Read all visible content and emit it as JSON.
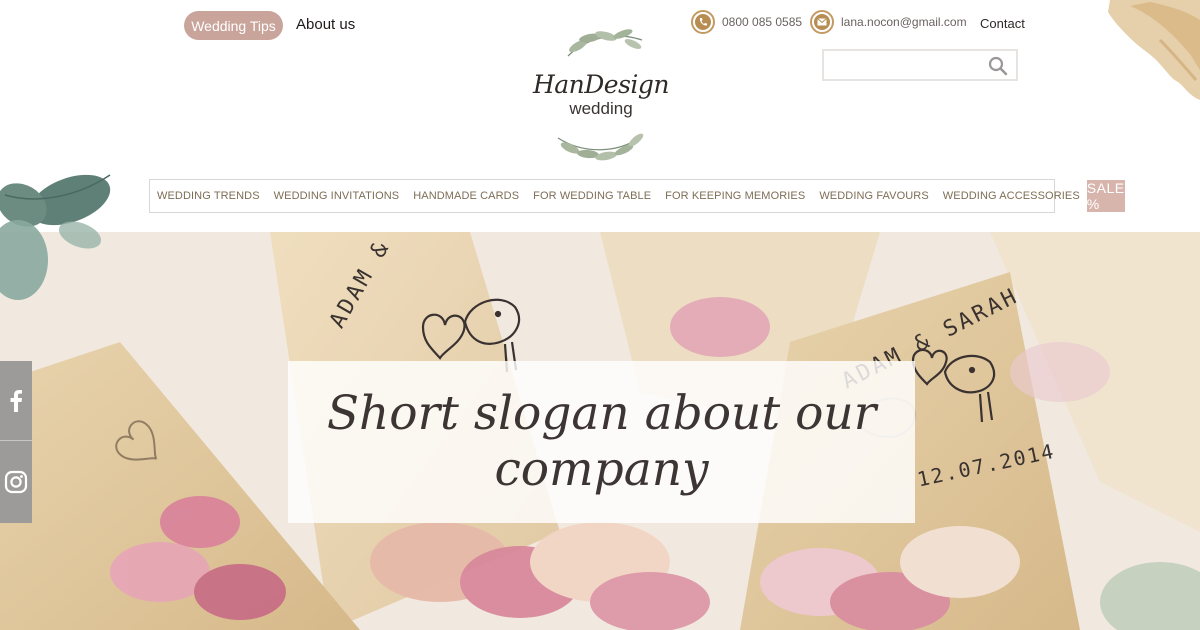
{
  "header": {
    "tips_button": "Wedding Tips",
    "about_link": "About us",
    "phone": "0800 085 0585",
    "email": "lana.nocon@gmail.com",
    "contact_link": "Contact",
    "search_placeholder": ""
  },
  "logo": {
    "name": "HanDesign",
    "subtitle": "wedding"
  },
  "nav": {
    "items": [
      "WEDDING TRENDS",
      "WEDDING INVITATIONS",
      "HANDMADE CARDS",
      "FOR WEDDING TABLE",
      "FOR KEEPING MEMORIES",
      "WEDDING FAVOURS",
      "WEDDING ACCESSORIES"
    ],
    "sale": "SALE %"
  },
  "hero": {
    "slogan": "Short slogan about our company",
    "cone_left_text": "ADAM & SARAH",
    "cone_right_text": "ADAM & SARAH",
    "cone_right_date": "12.07.2014"
  },
  "social": {
    "facebook_icon": "facebook-icon",
    "instagram_icon": "instagram-icon"
  },
  "colors": {
    "accent_pink": "#c9a49b",
    "sale_pink": "#d8b5ac",
    "gold": "#b88d52",
    "nav_text": "#7d6d55",
    "social_bar": "#9d9b9a"
  }
}
